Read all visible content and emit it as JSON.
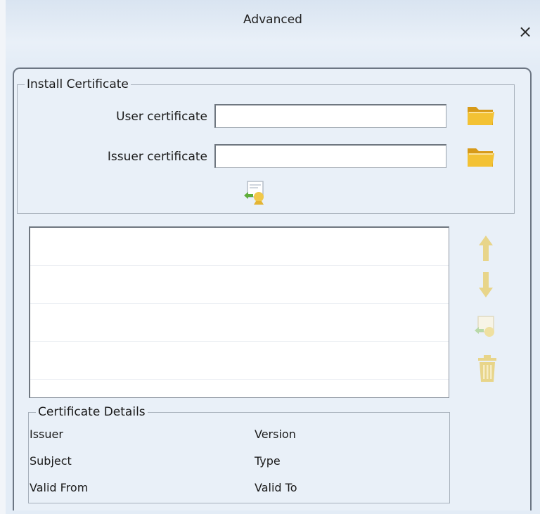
{
  "window": {
    "title": "Advanced",
    "close_label": "×"
  },
  "install_certificate": {
    "legend": "Install Certificate",
    "user_certificate_label": "User certificate",
    "user_certificate_value": "",
    "issuer_certificate_label": "Issuer certificate",
    "issuer_certificate_value": ""
  },
  "certificate_list": {
    "rows": 5,
    "items": []
  },
  "side_buttons": [
    "arrow-up-icon",
    "arrow-down-icon",
    "install-certificate-icon",
    "trash-icon"
  ],
  "certificate_details": {
    "legend": "Certificate Details",
    "issuer_label": "Issuer",
    "version_label": "Version",
    "subject_label": "Subject",
    "type_label": "Type",
    "valid_from_label": "Valid From",
    "valid_to_label": "Valid To"
  },
  "colors": {
    "folder": "#f3c234",
    "folder_dark": "#d79a18",
    "disabled_icon": "#e8d58a",
    "border": "#6c7683"
  }
}
